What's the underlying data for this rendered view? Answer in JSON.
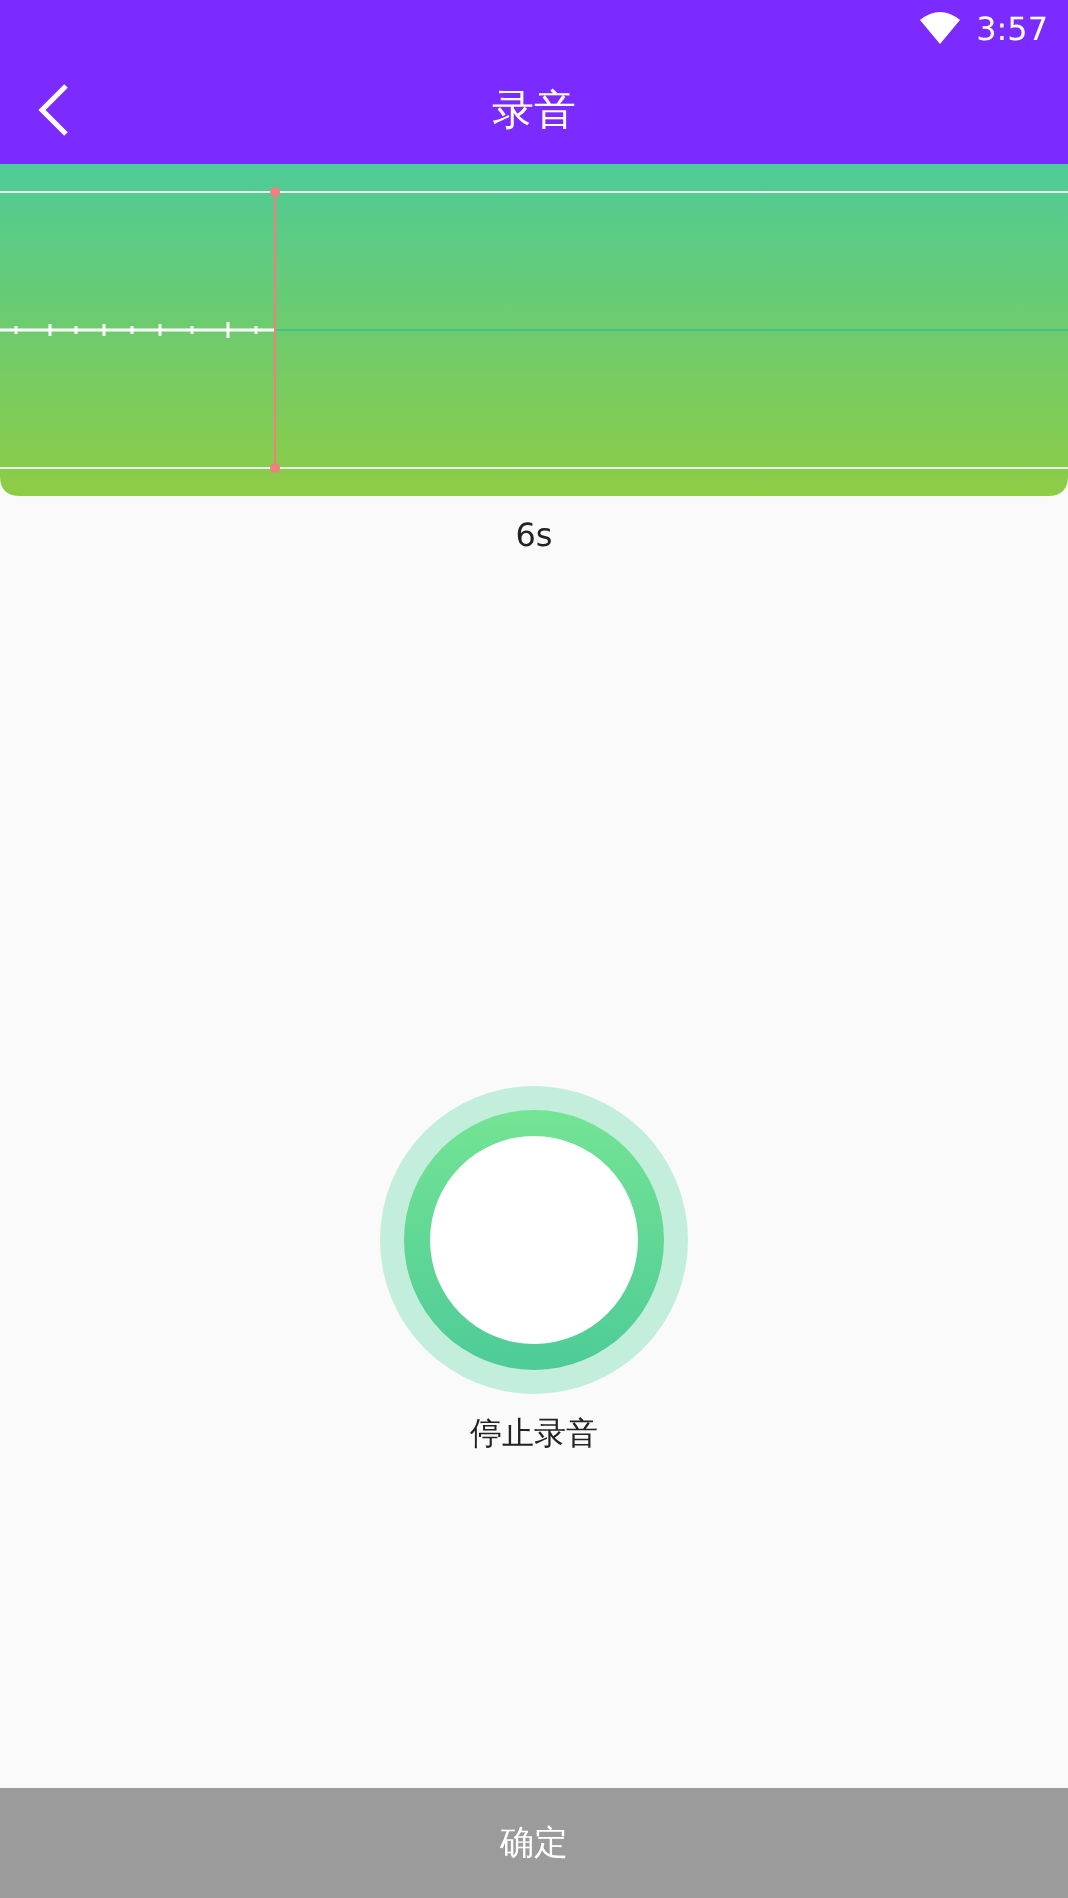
{
  "status_bar": {
    "time": "3:57"
  },
  "toolbar": {
    "title": "录音"
  },
  "recorder": {
    "duration": "6s",
    "action_label": "停止录音"
  },
  "confirm_button": {
    "label": "确定"
  }
}
